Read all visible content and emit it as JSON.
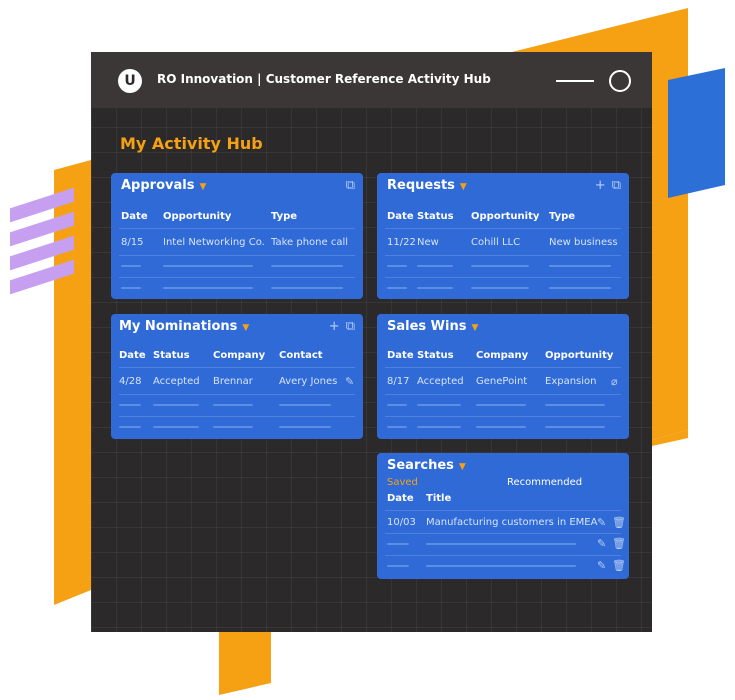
{
  "app": {
    "logo_letter": "U",
    "title": "RO Innovation  |  Customer Reference Activity Hub"
  },
  "page_title": "My Activity Hub",
  "approvals": {
    "title": "Approvals",
    "columns": [
      "Date",
      "Opportunity",
      "Type"
    ],
    "rows": [
      {
        "date": "8/15",
        "opportunity": "Intel Networking Co.",
        "type": "Take phone call"
      }
    ]
  },
  "requests": {
    "title": "Requests",
    "columns": [
      "Date",
      "Status",
      "Opportunity",
      "Type"
    ],
    "rows": [
      {
        "date": "11/22",
        "status": "New",
        "opportunity": "Cohill LLC",
        "type": "New business"
      }
    ]
  },
  "nominations": {
    "title": "My Nominations",
    "columns": [
      "Date",
      "Status",
      "Company",
      "Contact"
    ],
    "rows": [
      {
        "date": "4/28",
        "status": "Accepted",
        "company": "Brennar",
        "contact": "Avery Jones"
      }
    ]
  },
  "sales_wins": {
    "title": "Sales Wins",
    "columns": [
      "Date",
      "Status",
      "Company",
      "Opportunity"
    ],
    "rows": [
      {
        "date": "8/17",
        "status": "Accepted",
        "company": "GenePoint",
        "opportunity": "Expansion"
      }
    ]
  },
  "searches": {
    "title": "Searches",
    "tabs": {
      "saved": "Saved",
      "recommended": "Recommended"
    },
    "columns": [
      "Date",
      "Title"
    ],
    "rows": [
      {
        "date": "10/03",
        "title": "Manufacturing customers in EMEA"
      }
    ]
  },
  "colors": {
    "accent": "#f5a113",
    "card": "#2f6ad6",
    "window": "#2b2929",
    "decor_blue": "#2c6fd6",
    "decor_purple": "#c79ff0"
  },
  "icons": [
    "external-link-icon",
    "plus-icon",
    "edit-icon",
    "trash-icon",
    "paperclip-icon",
    "caret-down-icon"
  ]
}
